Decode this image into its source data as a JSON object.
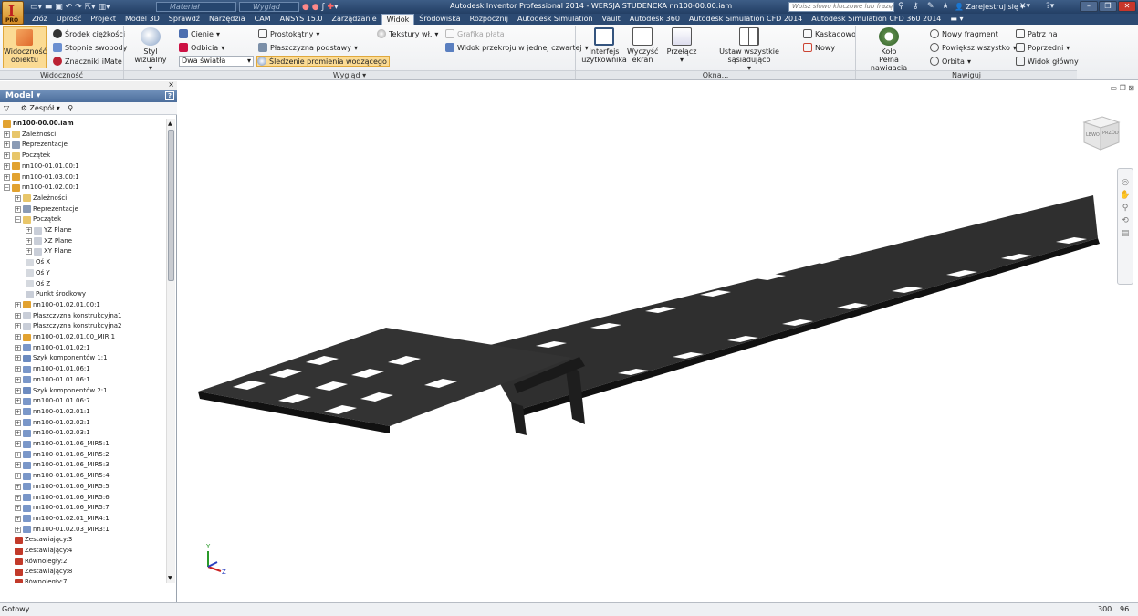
{
  "app": {
    "badge": "PRO",
    "title": "Autodesk Inventor Professional 2014 - WERSJA STUDENCKA    nn100-00.00.iam"
  },
  "quick_access": {
    "material_placeholder": "Materiał",
    "appearance_placeholder": "Wygląd",
    "search_placeholder": "Wpisz słowo kluczowe lub frazę",
    "signin_label": "Zarejestruj się"
  },
  "menu": [
    "Złóż",
    "Uprość",
    "Projekt",
    "Model 3D",
    "Sprawdź",
    "Narzędzia",
    "CAM",
    "ANSYS 15.0",
    "Zarządzanie",
    "Widok",
    "Środowiska",
    "Rozpocznij",
    "Autodesk Simulation",
    "Vault",
    "Autodesk 360",
    "Autodesk Simulation CFD 2014",
    "Autodesk Simulation CFD 360 2014"
  ],
  "menu_active": "Widok",
  "ribbon": {
    "visibility": {
      "big": "Widoczność\nobiektu",
      "items": [
        "Środek ciężkości",
        "Stopnie swobody",
        "Znaczniki iMate"
      ],
      "group": "Widoczność"
    },
    "appearance": {
      "visual_style": "Styl wizualny",
      "shadows": "Cienie",
      "reflections": "Odbicia",
      "lighting": "Dwa światła",
      "ortho": "Prostokątny",
      "ground": "Płaszczyzna podstawy",
      "ray": "Śledzenie promienia wodzącego",
      "textures": "Tekstury wł.",
      "plate": "Grafika płata",
      "section": "Widok przekroju w jednej czwartej",
      "group": "Wygląd"
    },
    "windows": {
      "ui": "Interfejs\nużytkownika",
      "clear": "Wyczyść\nekran",
      "switch": "Przełącz",
      "arrange": "Ustaw wszystkie sąsiadująco",
      "cascade": "Kaskadowo",
      "new": "Nowy",
      "group": "Okna..."
    },
    "navigate": {
      "wheel": "Koło\nPełna nawigacja",
      "new_fragment": "Nowy fragment",
      "zoom_all": "Powiększ wszystko",
      "orbit": "Orbita",
      "look_at": "Patrz na",
      "previous": "Poprzedni",
      "home": "Widok główny",
      "group": "Nawiguj"
    }
  },
  "browser": {
    "header": "Model",
    "filter_label": "Zespół",
    "root": "nn100-00.00.iam",
    "items": [
      {
        "label": "Zależności",
        "level": 1,
        "icon": "folder"
      },
      {
        "label": "Reprezentacje",
        "level": 1,
        "icon": "rep"
      },
      {
        "label": "Początek",
        "level": 1,
        "icon": "folder"
      },
      {
        "label": "nn100-01.01.00:1",
        "level": 1,
        "icon": "asm-red"
      },
      {
        "label": "nn100-01.03.00:1",
        "level": 1,
        "icon": "asm"
      },
      {
        "label": "nn100-01.02.00:1",
        "level": 1,
        "icon": "asm"
      },
      {
        "label": "Zależności",
        "level": 2,
        "icon": "folder"
      },
      {
        "label": "Reprezentacje",
        "level": 2,
        "icon": "rep"
      },
      {
        "label": "Początek",
        "level": 2,
        "icon": "folder-open"
      },
      {
        "label": "YZ Plane",
        "level": 3,
        "icon": "plane"
      },
      {
        "label": "XZ Plane",
        "level": 3,
        "icon": "plane"
      },
      {
        "label": "XY Plane",
        "level": 3,
        "icon": "plane"
      },
      {
        "label": "Oś X",
        "level": 3,
        "icon": "axis"
      },
      {
        "label": "Oś Y",
        "level": 3,
        "icon": "axis"
      },
      {
        "label": "Oś Z",
        "level": 3,
        "icon": "axis"
      },
      {
        "label": "Punkt środkowy",
        "level": 3,
        "icon": "point"
      },
      {
        "label": "nn100-01.02.01.00:1",
        "level": 2,
        "icon": "asm"
      },
      {
        "label": "Płaszczyzna konstrukcyjna1",
        "level": 2,
        "icon": "plane"
      },
      {
        "label": "Płaszczyzna konstrukcyjna2",
        "level": 2,
        "icon": "plane"
      },
      {
        "label": "nn100-01.02.01.00_MIR:1",
        "level": 2,
        "icon": "asm"
      },
      {
        "label": "nn100-01.01.02:1",
        "level": 2,
        "icon": "part"
      },
      {
        "label": "Szyk komponentów 1:1",
        "level": 2,
        "icon": "pattern"
      },
      {
        "label": "nn100-01.01.06:1",
        "level": 2,
        "icon": "part"
      },
      {
        "label": "nn100-01.01.06:1",
        "level": 2,
        "icon": "part"
      },
      {
        "label": "Szyk komponentów 2:1",
        "level": 2,
        "icon": "pattern"
      },
      {
        "label": "nn100-01.01.06:7",
        "level": 2,
        "icon": "part"
      },
      {
        "label": "nn100-01.02.01:1",
        "level": 2,
        "icon": "part"
      },
      {
        "label": "nn100-01.02.02:1",
        "level": 2,
        "icon": "part"
      },
      {
        "label": "nn100-01.02.03:1",
        "level": 2,
        "icon": "part"
      },
      {
        "label": "nn100-01.01.06_MIR5:1",
        "level": 2,
        "icon": "part"
      },
      {
        "label": "nn100-01.01.06_MIR5:2",
        "level": 2,
        "icon": "part"
      },
      {
        "label": "nn100-01.01.06_MIR5:3",
        "level": 2,
        "icon": "part"
      },
      {
        "label": "nn100-01.01.06_MIR5:4",
        "level": 2,
        "icon": "part"
      },
      {
        "label": "nn100-01.01.06_MIR5:5",
        "level": 2,
        "icon": "part"
      },
      {
        "label": "nn100-01.01.06_MIR5:6",
        "level": 2,
        "icon": "part"
      },
      {
        "label": "nn100-01.01.06_MIR5:7",
        "level": 2,
        "icon": "part"
      },
      {
        "label": "nn100-01.02.01_MIR4:1",
        "level": 2,
        "icon": "part"
      },
      {
        "label": "nn100-01.02.03_MIR3:1",
        "level": 2,
        "icon": "part"
      },
      {
        "label": "Zestawiający:3",
        "level": 2,
        "icon": "constraint"
      },
      {
        "label": "Zestawiający:4",
        "level": 2,
        "icon": "constraint"
      },
      {
        "label": "Równoległy:2",
        "level": 2,
        "icon": "parallel"
      },
      {
        "label": "Zestawiający:8",
        "level": 2,
        "icon": "constraint"
      },
      {
        "label": "Równoległy:7",
        "level": 2,
        "icon": "parallel"
      }
    ]
  },
  "viewcube": {
    "left_face": "LEWO",
    "front_face": "PRZÓD"
  },
  "status": {
    "text": "Gotowy",
    "n1": "300",
    "n2": "96"
  }
}
